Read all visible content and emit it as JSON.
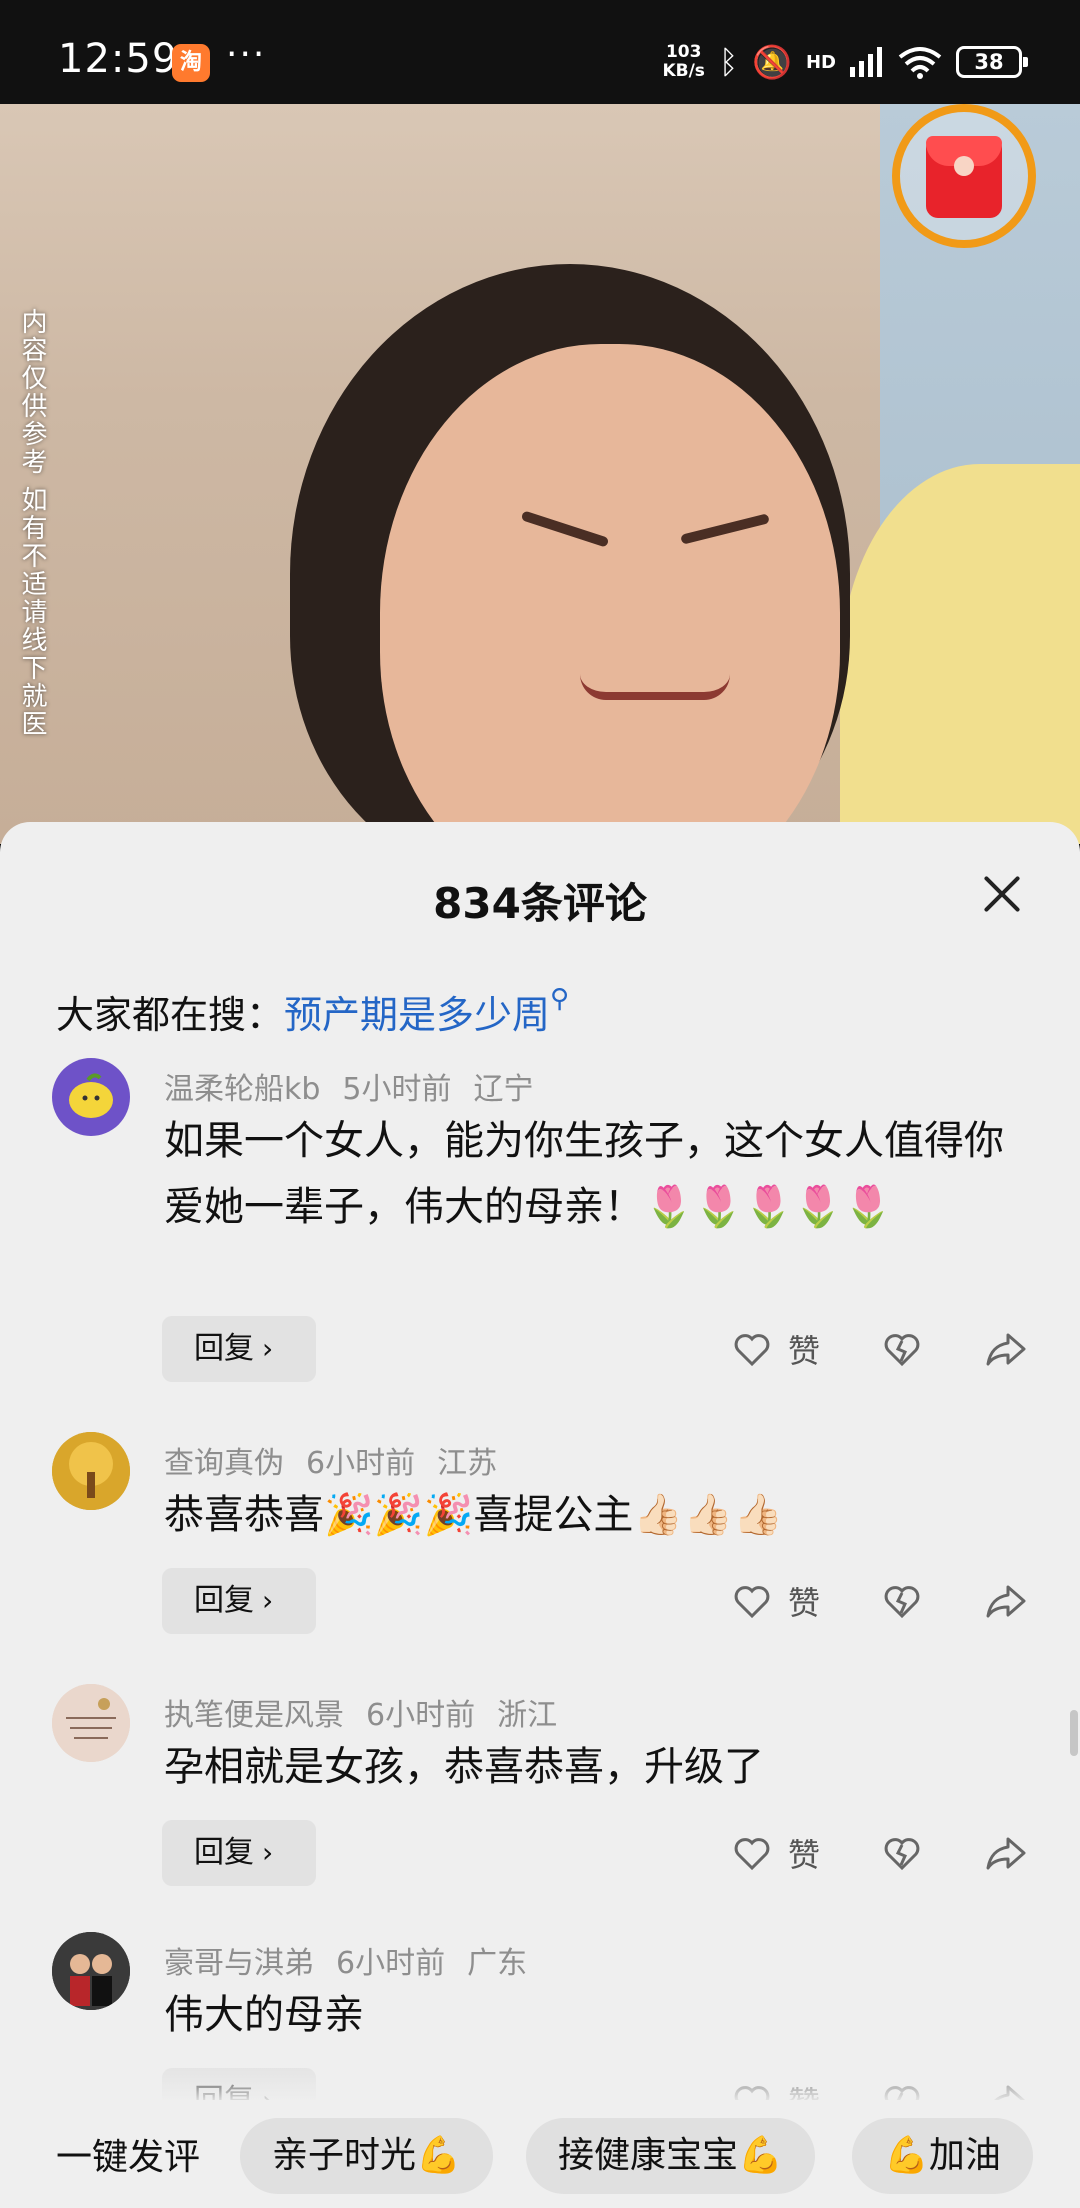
{
  "status_bar": {
    "time": "12:59",
    "app_icon": "taobao-icon",
    "more": "···",
    "net_speed_value": "103",
    "net_speed_unit": "KB/s",
    "signal_label": "HD",
    "battery": "38"
  },
  "video": {
    "vertical_note": "内容仅供参考 如有不适请线下就医",
    "red_packet_icon": "red-envelope-icon"
  },
  "comments_sheet": {
    "title": "834条评论",
    "trending_prefix": "大家都在搜：",
    "trending_query": "预产期是多少周",
    "comments": [
      {
        "user": "温柔轮船kb",
        "time": "5小时前",
        "location": "辽宁",
        "text": "如果一个女人，能为你生孩子，这个女人值得你爱她一辈子，伟大的母亲！🌷🌷🌷🌷🌷",
        "reply_label": "回复",
        "like_label": "赞",
        "avatar_color": "#6e52c8"
      },
      {
        "user": "查询真伪",
        "time": "6小时前",
        "location": "江苏",
        "text": "恭喜恭喜🎉🎉🎉喜提公主👍🏻👍🏻👍🏻",
        "reply_label": "回复",
        "like_label": "赞",
        "avatar_color": "#c8a03a"
      },
      {
        "user": "执笔便是风景",
        "time": "6小时前",
        "location": "浙江",
        "text": "孕相就是女孩，恭喜恭喜，升级了",
        "reply_label": "回复",
        "like_label": "赞",
        "avatar_color": "#e7d2c6"
      },
      {
        "user": "豪哥与淇弟",
        "time": "6小时前",
        "location": "广东",
        "text": "伟大的母亲",
        "reply_label": "回复",
        "like_label": "赞",
        "avatar_color": "#2a2a2a"
      }
    ]
  },
  "quick_bar": {
    "label": "一键发评",
    "chips": [
      "亲子时光💪",
      "接健康宝宝💪",
      "💪加油"
    ]
  }
}
